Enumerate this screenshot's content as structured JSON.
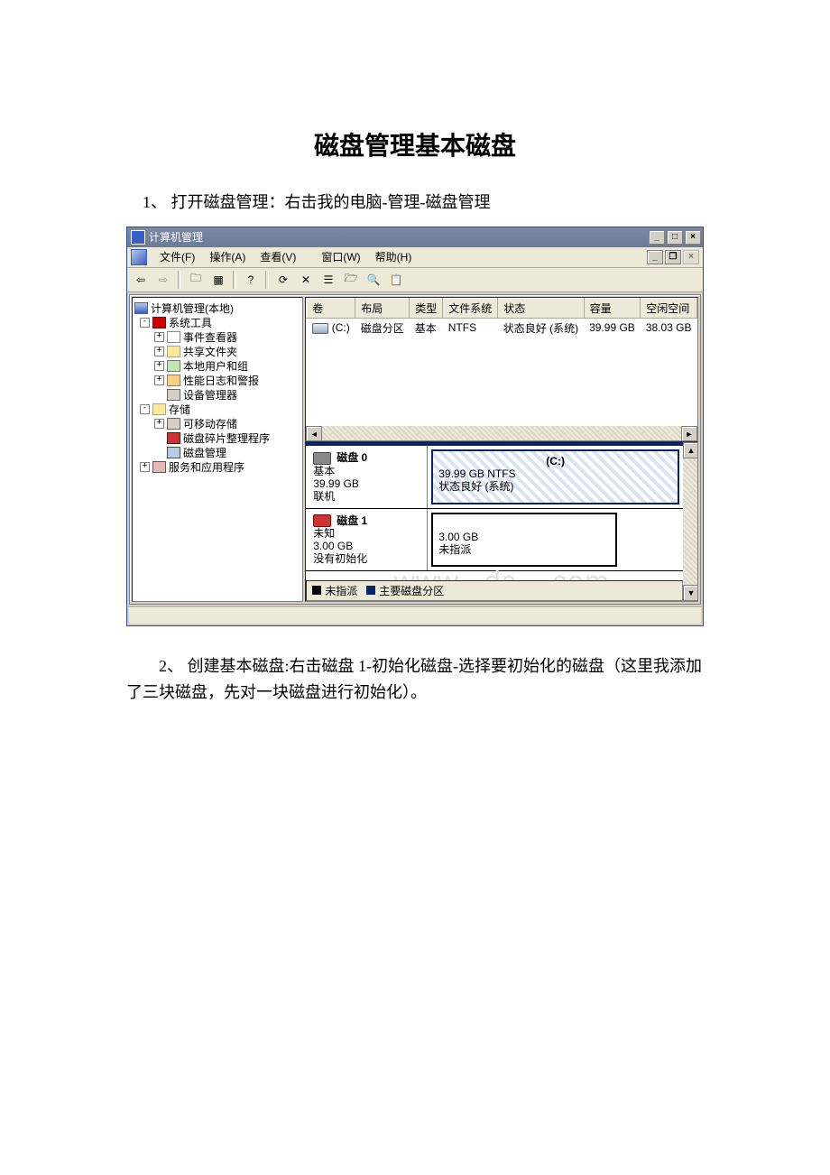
{
  "doc": {
    "title": "磁盘管理基本磁盘",
    "step1": "1、 打开磁盘管理：右击我的电脑-管理-磁盘管理",
    "step2": "2、 创建基本磁盘:右击磁盘 1-初始化磁盘-选择要初始化的磁盘（这里我添加了三块磁盘，先对一块磁盘进行初始化）。"
  },
  "app": {
    "title": "计算机管理",
    "menu": {
      "file": "文件(F)",
      "action": "操作(A)",
      "view": "查看(V)",
      "window": "窗口(W)",
      "help": "帮助(H)"
    },
    "tree": {
      "root": "计算机管理(本地)",
      "systools": "系统工具",
      "event": "事件查看器",
      "shared": "共享文件夹",
      "users": "本地用户和组",
      "perf": "性能日志和警报",
      "devmgr": "设备管理器",
      "storage": "存储",
      "removable": "可移动存储",
      "defrag": "磁盘碎片整理程序",
      "diskmgmt": "磁盘管理",
      "services": "服务和应用程序"
    },
    "grid": {
      "cols": {
        "vol": "卷",
        "layout": "布局",
        "type": "类型",
        "fs": "文件系统",
        "status": "状态",
        "cap": "容量",
        "free": "空闲空间"
      },
      "row": {
        "vol": "(C:)",
        "layout": "磁盘分区",
        "type": "基本",
        "fs": "NTFS",
        "status": "状态良好 (系统)",
        "cap": "39.99 GB",
        "free": "38.03 GB"
      }
    },
    "disks": {
      "d0": {
        "title": "磁盘 0",
        "kind": "基本",
        "size": "39.99 GB",
        "state": "联机",
        "pvol": "(C:)",
        "pdesc": "39.99 GB NTFS",
        "pstat": "状态良好 (系统)"
      },
      "d1": {
        "title": "磁盘 1",
        "kind": "未知",
        "size": "3.00 GB",
        "state": "没有初始化",
        "pdesc": "3.00 GB",
        "pstat": "未指派"
      }
    },
    "legend": {
      "unalloc": "未指派",
      "primary": "主要磁盘分区"
    }
  }
}
